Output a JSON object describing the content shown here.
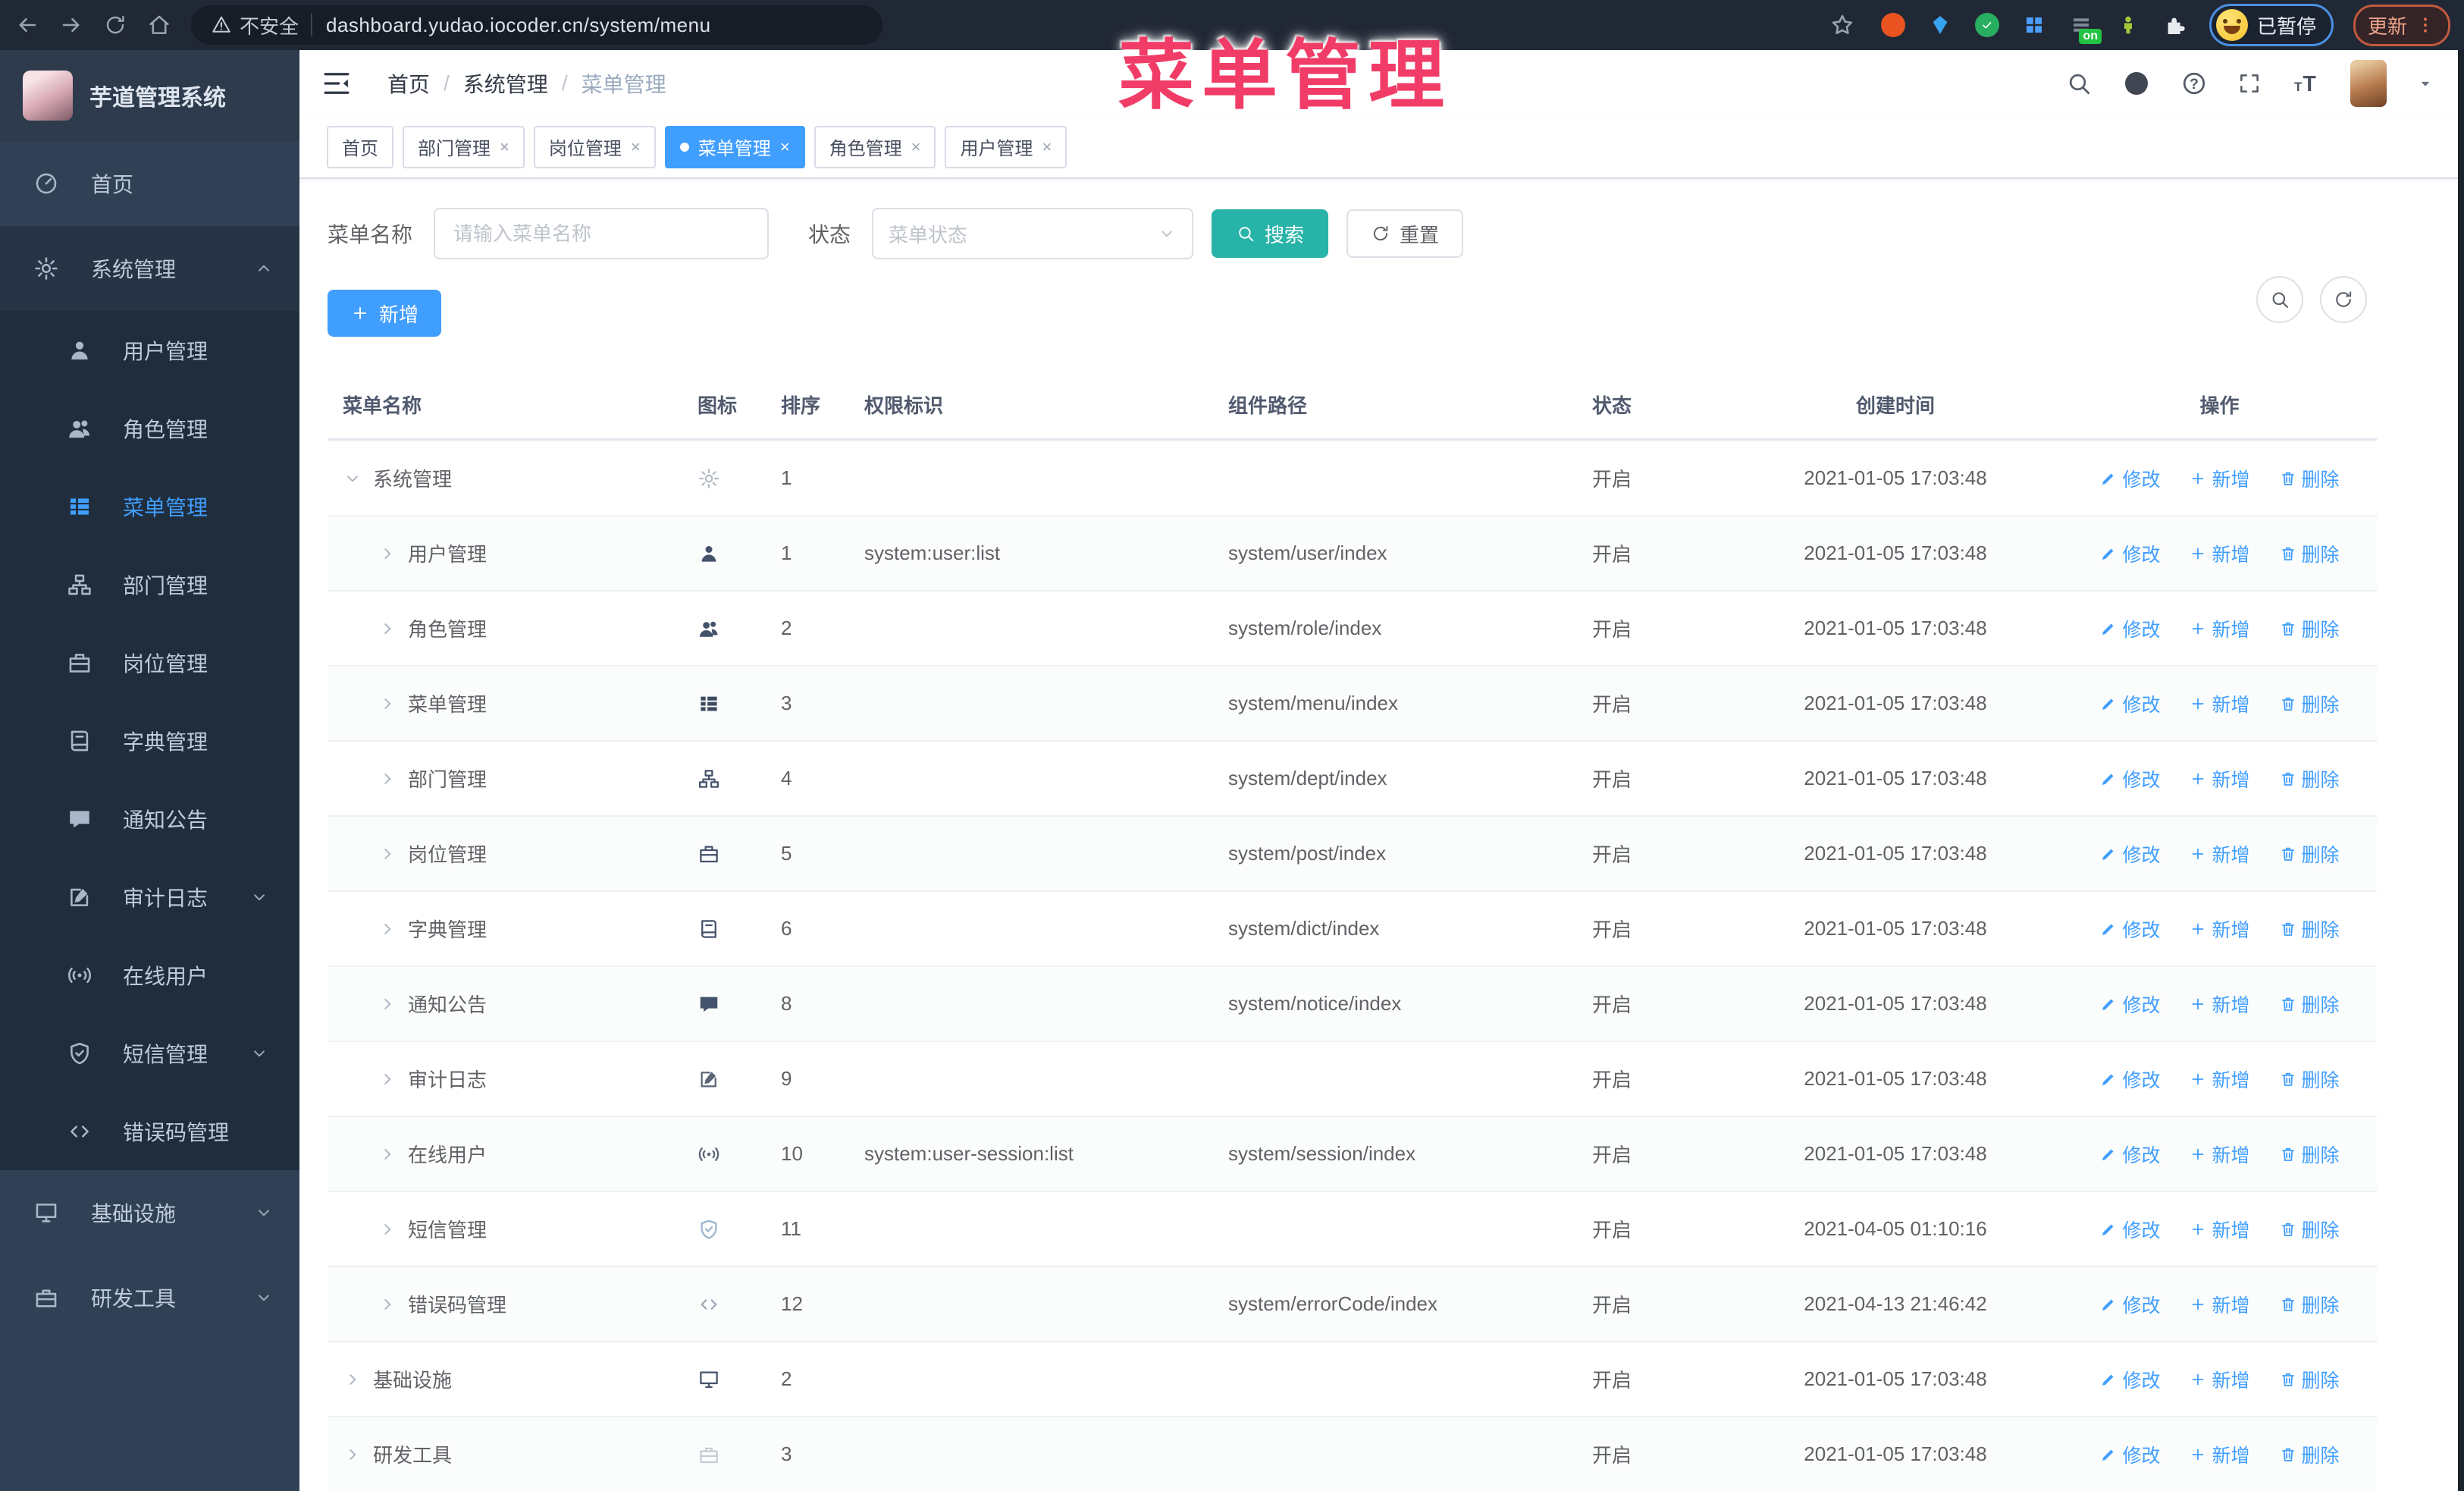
{
  "browser": {
    "security_label": "不安全",
    "url": "dashboard.yudao.iocoder.cn/system/menu",
    "paused_badge": "已暂停",
    "update_button": "更新",
    "extensions": [
      {
        "icon": "ubuntu-extension",
        "color": "#e95420",
        "badge": ""
      },
      {
        "icon": "gem-extension",
        "color": "#38a4f0",
        "badge": ""
      },
      {
        "icon": "check-extension",
        "color": "#27ae60",
        "badge": ""
      },
      {
        "icon": "grid-extension",
        "color": "#4d9fff",
        "badge": ""
      },
      {
        "icon": "stack-extension",
        "color": "#39414d",
        "badge": "on"
      },
      {
        "icon": "android-extension",
        "color": "#a4c639",
        "badge": ""
      },
      {
        "icon": "puzzle-extension",
        "color": "#e8eaed",
        "badge": ""
      }
    ]
  },
  "annotation": {
    "text": "菜单管理"
  },
  "sidebar": {
    "logo_title": "芋道管理系统",
    "items": [
      {
        "icon": "dashboard",
        "label": "首页",
        "level": 0,
        "arrow": "",
        "active": false,
        "parent_open": false
      },
      {
        "icon": "gear",
        "label": "系统管理",
        "level": 0,
        "arrow": "up",
        "active": false,
        "parent_open": true
      },
      {
        "icon": "user",
        "label": "用户管理",
        "level": 1,
        "arrow": "",
        "active": false
      },
      {
        "icon": "peoples",
        "label": "角色管理",
        "level": 1,
        "arrow": "",
        "active": false
      },
      {
        "icon": "tree-table",
        "label": "菜单管理",
        "level": 1,
        "arrow": "",
        "active": true
      },
      {
        "icon": "tree",
        "label": "部门管理",
        "level": 1,
        "arrow": "",
        "active": false
      },
      {
        "icon": "post",
        "label": "岗位管理",
        "level": 1,
        "arrow": "",
        "active": false
      },
      {
        "icon": "dict",
        "label": "字典管理",
        "level": 1,
        "arrow": "",
        "active": false
      },
      {
        "icon": "message",
        "label": "通知公告",
        "level": 1,
        "arrow": "",
        "active": false
      },
      {
        "icon": "log",
        "label": "审计日志",
        "level": 1,
        "arrow": "down",
        "active": false
      },
      {
        "icon": "online",
        "label": "在线用户",
        "level": 1,
        "arrow": "",
        "active": false
      },
      {
        "icon": "shield",
        "label": "短信管理",
        "level": 1,
        "arrow": "down",
        "active": false
      },
      {
        "icon": "code",
        "label": "错误码管理",
        "level": 1,
        "arrow": "",
        "active": false
      },
      {
        "icon": "monitor",
        "label": "基础设施",
        "level": 0,
        "arrow": "down",
        "active": false,
        "parent_open": false
      },
      {
        "icon": "toolbox",
        "label": "研发工具",
        "level": 0,
        "arrow": "down",
        "active": false,
        "parent_open": false
      }
    ]
  },
  "header": {
    "breadcrumb": [
      "首页",
      "系统管理",
      "菜单管理"
    ]
  },
  "tabbar": {
    "tabs": [
      {
        "label": "首页",
        "closable": false,
        "active": false
      },
      {
        "label": "部门管理",
        "closable": true,
        "active": false
      },
      {
        "label": "岗位管理",
        "closable": true,
        "active": false
      },
      {
        "label": "菜单管理",
        "closable": true,
        "active": true
      },
      {
        "label": "角色管理",
        "closable": true,
        "active": false
      },
      {
        "label": "用户管理",
        "closable": true,
        "active": false
      }
    ]
  },
  "filters": {
    "name_label": "菜单名称",
    "name_placeholder": "请输入菜单名称",
    "status_label": "状态",
    "status_placeholder": "菜单状态",
    "search_label": "搜索",
    "reset_label": "重置"
  },
  "toolbar": {
    "add_label": "新增"
  },
  "table": {
    "columns": [
      "菜单名称",
      "图标",
      "排序",
      "权限标识",
      "组件路径",
      "状态",
      "创建时间",
      "操作"
    ],
    "rows": [
      {
        "name": "系统管理",
        "icon": "gear",
        "icon_color": "#b3bac4",
        "sort": "1",
        "perm": "",
        "path": "",
        "status": "开启",
        "time": "2021-01-05 17:03:48",
        "level": 0,
        "expand": "down"
      },
      {
        "name": "用户管理",
        "icon": "user",
        "icon_color": "#45526b",
        "sort": "1",
        "perm": "system:user:list",
        "path": "system/user/index",
        "status": "开启",
        "time": "2021-01-05 17:03:48",
        "level": 1,
        "expand": "right"
      },
      {
        "name": "角色管理",
        "icon": "peoples",
        "icon_color": "#45526b",
        "sort": "2",
        "perm": "",
        "path": "system/role/index",
        "status": "开启",
        "time": "2021-01-05 17:03:48",
        "level": 1,
        "expand": "right"
      },
      {
        "name": "菜单管理",
        "icon": "tree-table",
        "icon_color": "#3c4a5e",
        "sort": "3",
        "perm": "",
        "path": "system/menu/index",
        "status": "开启",
        "time": "2021-01-05 17:03:48",
        "level": 1,
        "expand": "right"
      },
      {
        "name": "部门管理",
        "icon": "tree",
        "icon_color": "#45526b",
        "sort": "4",
        "perm": "",
        "path": "system/dept/index",
        "status": "开启",
        "time": "2021-01-05 17:03:48",
        "level": 1,
        "expand": "right"
      },
      {
        "name": "岗位管理",
        "icon": "post",
        "icon_color": "#45526b",
        "sort": "5",
        "perm": "",
        "path": "system/post/index",
        "status": "开启",
        "time": "2021-01-05 17:03:48",
        "level": 1,
        "expand": "right"
      },
      {
        "name": "字典管理",
        "icon": "dict",
        "icon_color": "#45526b",
        "sort": "6",
        "perm": "",
        "path": "system/dict/index",
        "status": "开启",
        "time": "2021-01-05 17:03:48",
        "level": 1,
        "expand": "right"
      },
      {
        "name": "通知公告",
        "icon": "message",
        "icon_color": "#45526b",
        "sort": "8",
        "perm": "",
        "path": "system/notice/index",
        "status": "开启",
        "time": "2021-01-05 17:03:48",
        "level": 1,
        "expand": "right"
      },
      {
        "name": "审计日志",
        "icon": "log",
        "icon_color": "#5a6577",
        "sort": "9",
        "perm": "",
        "path": "",
        "status": "开启",
        "time": "2021-01-05 17:03:48",
        "level": 1,
        "expand": "right"
      },
      {
        "name": "在线用户",
        "icon": "online",
        "icon_color": "#5a6577",
        "sort": "10",
        "perm": "system:user-session:list",
        "path": "system/session/index",
        "status": "开启",
        "time": "2021-01-05 17:03:48",
        "level": 1,
        "expand": "right"
      },
      {
        "name": "短信管理",
        "icon": "shield",
        "icon_color": "#9db4cc",
        "sort": "11",
        "perm": "",
        "path": "",
        "status": "开启",
        "time": "2021-04-05 01:10:16",
        "level": 1,
        "expand": "right"
      },
      {
        "name": "错误码管理",
        "icon": "code",
        "icon_color": "#9aa5b3",
        "sort": "12",
        "perm": "",
        "path": "system/errorCode/index",
        "status": "开启",
        "time": "2021-04-13 21:46:42",
        "level": 1,
        "expand": "right"
      },
      {
        "name": "基础设施",
        "icon": "monitor",
        "icon_color": "#45526b",
        "sort": "2",
        "perm": "",
        "path": "",
        "status": "开启",
        "time": "2021-01-05 17:03:48",
        "level": 0,
        "expand": "right"
      },
      {
        "name": "研发工具",
        "icon": "toolbox",
        "icon_color": "#c6ccd4",
        "sort": "3",
        "perm": "",
        "path": "",
        "status": "开启",
        "time": "2021-01-05 17:03:48",
        "level": 0,
        "expand": "right"
      }
    ]
  },
  "row_actions": {
    "edit": "修改",
    "add": "新增",
    "delete": "删除"
  },
  "colors": {
    "accent": "#409eff",
    "search_button": "#28b3a8",
    "annotation": "#f23c68",
    "sidebar_bg": "#304156",
    "submenu_bg": "#1f2d3d"
  }
}
